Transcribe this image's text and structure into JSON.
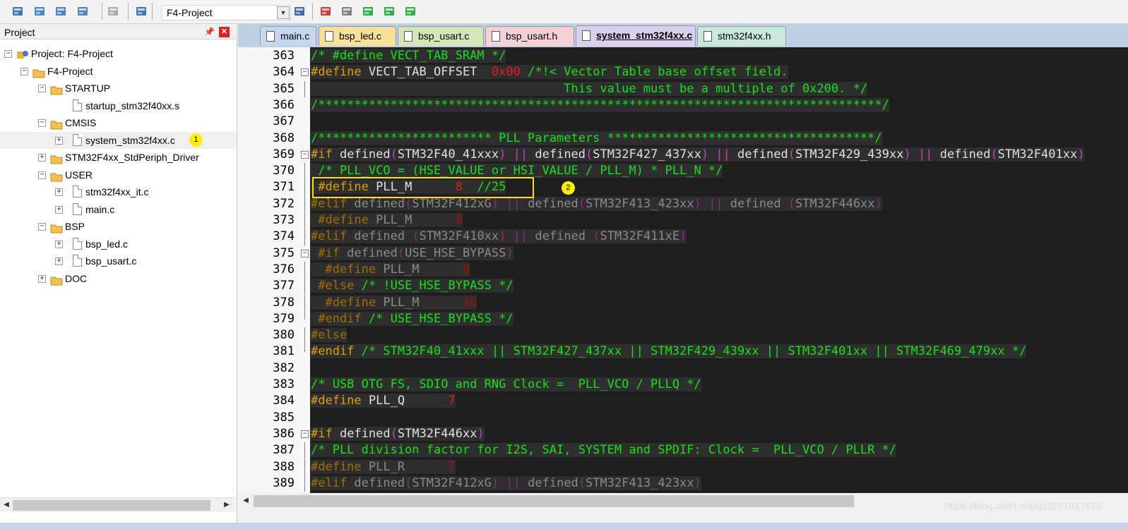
{
  "toolbar": {
    "target_name": "F4-Project",
    "buttons": [
      {
        "name": "translate-icon",
        "color": "#2060b0"
      },
      {
        "name": "build-icon",
        "color": "#3070c0"
      },
      {
        "name": "rebuild-icon",
        "color": "#3070c0"
      },
      {
        "name": "batch-build-icon",
        "color": "#3070c0"
      },
      {
        "name": "stop-build-icon",
        "color": "#9aa0a8"
      },
      {
        "name": "download-icon",
        "color": "#2060b0"
      },
      {
        "name": "options-for-target-icon",
        "color": "#2050a0"
      },
      {
        "name": "manage-project-items-icon",
        "color": "#c02020"
      },
      {
        "name": "select-packs-icon",
        "color": "#707070"
      },
      {
        "name": "manage-rte-icon",
        "color": "#10a030"
      },
      {
        "name": "pack-installer-icon",
        "color": "#10a030"
      },
      {
        "name": "pack-installer2-icon",
        "color": "#10a030"
      }
    ]
  },
  "project_panel": {
    "title": "Project",
    "tree": [
      {
        "label": "Project: F4-Project",
        "level": 0,
        "type": "project",
        "toggle": "-"
      },
      {
        "label": "F4-Project",
        "level": 1,
        "type": "target",
        "toggle": "-"
      },
      {
        "label": "STARTUP",
        "level": 2,
        "type": "folder",
        "toggle": "-"
      },
      {
        "label": "startup_stm32f40xx.s",
        "level": 3,
        "type": "file",
        "toggle": ""
      },
      {
        "label": "CMSIS",
        "level": 2,
        "type": "folder",
        "toggle": "-"
      },
      {
        "label": "system_stm32f4xx.c",
        "level": 3,
        "type": "file",
        "toggle": "+",
        "selected": true,
        "badge": "1"
      },
      {
        "label": "STM32F4xx_StdPeriph_Driver",
        "level": 2,
        "type": "folder",
        "toggle": "+"
      },
      {
        "label": "USER",
        "level": 2,
        "type": "folder",
        "toggle": "-"
      },
      {
        "label": "stm32f4xx_it.c",
        "level": 3,
        "type": "file",
        "toggle": "+"
      },
      {
        "label": "main.c",
        "level": 3,
        "type": "file",
        "toggle": "+"
      },
      {
        "label": "BSP",
        "level": 2,
        "type": "folder",
        "toggle": "-"
      },
      {
        "label": "bsp_led.c",
        "level": 3,
        "type": "file",
        "toggle": "+"
      },
      {
        "label": "bsp_usart.c",
        "level": 3,
        "type": "file",
        "toggle": "+"
      },
      {
        "label": "DOC",
        "level": 2,
        "type": "folder",
        "toggle": "+"
      }
    ]
  },
  "tabs": [
    {
      "label": "main.c",
      "color": "#c4d7ee",
      "active": false
    },
    {
      "label": "bsp_led.c",
      "color": "#f6e09a",
      "active": false
    },
    {
      "label": "bsp_usart.c",
      "color": "#d4e6b8",
      "active": false
    },
    {
      "label": "bsp_usart.h",
      "color": "#f4d0d4",
      "active": false
    },
    {
      "label": "system_stm32f4xx.c",
      "color": "#d8d0ec",
      "active": true
    },
    {
      "label": "stm32f4xx.h",
      "color": "#c8e8dc",
      "active": false
    }
  ],
  "editor": {
    "highlight_badge": "2",
    "lines": [
      {
        "num": "363",
        "fold": "",
        "segs": [
          [
            "c",
            "/* #define VECT_TAB_SRAM */"
          ]
        ]
      },
      {
        "num": "364",
        "fold": "-",
        "segs": [
          [
            "p",
            "#define"
          ],
          [
            "d",
            " VECT_TAB_OFFSET  "
          ],
          [
            "n",
            "0x00"
          ],
          [
            "c",
            " /*!< Vector Table base offset field."
          ]
        ]
      },
      {
        "num": "365",
        "fold": "|",
        "segs": [
          [
            "c",
            "                                   This value must be a multiple of 0x200. */"
          ]
        ]
      },
      {
        "num": "366",
        "fold": "",
        "segs": [
          [
            "c",
            "/******************************************************************************/"
          ]
        ]
      },
      {
        "num": "367",
        "fold": "",
        "segs": []
      },
      {
        "num": "368",
        "fold": "",
        "segs": [
          [
            "c",
            "/************************ PLL Parameters *************************************/"
          ]
        ]
      },
      {
        "num": "369",
        "fold": "-",
        "segs": [
          [
            "p",
            "#if"
          ],
          [
            "d",
            " defined"
          ],
          [
            "o",
            "("
          ],
          [
            "d",
            "STM32F40_41xxx"
          ],
          [
            "o",
            ")"
          ],
          [
            "d",
            " "
          ],
          [
            "o",
            "||"
          ],
          [
            "d",
            " defined"
          ],
          [
            "o",
            "("
          ],
          [
            "d",
            "STM32F427_437xx"
          ],
          [
            "o",
            ")"
          ],
          [
            "d",
            " "
          ],
          [
            "o",
            "||"
          ],
          [
            "d",
            " defined"
          ],
          [
            "o",
            "("
          ],
          [
            "d",
            "STM32F429_439xx"
          ],
          [
            "o",
            ")"
          ],
          [
            "d",
            " "
          ],
          [
            "o",
            "||"
          ],
          [
            "d",
            " defined"
          ],
          [
            "o",
            "("
          ],
          [
            "d",
            "STM32F401xx"
          ],
          [
            "o",
            ")"
          ]
        ]
      },
      {
        "num": "370",
        "fold": "|",
        "segs": [
          [
            "c",
            " /* PLL_VCO = (HSE_VALUE or HSI_VALUE / PLL_M) * PLL_N */"
          ]
        ]
      },
      {
        "num": "371",
        "fold": "|",
        "segs": [
          [
            "p",
            " #define"
          ],
          [
            "d",
            " PLL_M      "
          ],
          [
            "n",
            "8"
          ],
          [
            "c",
            "  //25"
          ]
        ]
      },
      {
        "num": "372",
        "fold": "|",
        "segs": [
          [
            "pd",
            "#elif"
          ],
          [
            "dd2",
            " defined"
          ],
          [
            "od",
            "("
          ],
          [
            "dd2",
            "STM32F412xG"
          ],
          [
            "od",
            ")"
          ],
          [
            "dd2",
            " "
          ],
          [
            "od",
            "||"
          ],
          [
            "dd2",
            " defined"
          ],
          [
            "od",
            "("
          ],
          [
            "dd2",
            "STM32F413_423xx"
          ],
          [
            "od",
            ")"
          ],
          [
            "dd2",
            " "
          ],
          [
            "od",
            "||"
          ],
          [
            "dd2",
            " defined "
          ],
          [
            "od",
            "("
          ],
          [
            "dd2",
            "STM32F446xx"
          ],
          [
            "od",
            ")"
          ]
        ]
      },
      {
        "num": "373",
        "fold": "|",
        "segs": [
          [
            "pd",
            " #define"
          ],
          [
            "dd2",
            " PLL_M      "
          ],
          [
            "nd",
            "8"
          ]
        ]
      },
      {
        "num": "374",
        "fold": "|",
        "segs": [
          [
            "pd",
            "#elif"
          ],
          [
            "dd2",
            " defined "
          ],
          [
            "od",
            "("
          ],
          [
            "dd2",
            "STM32F410xx"
          ],
          [
            "od",
            ")"
          ],
          [
            "dd2",
            " "
          ],
          [
            "od",
            "||"
          ],
          [
            "dd2",
            " defined "
          ],
          [
            "od",
            "("
          ],
          [
            "dd2",
            "STM32F411xE"
          ],
          [
            "od",
            ")"
          ]
        ]
      },
      {
        "num": "375",
        "fold": "-",
        "segs": [
          [
            "pd",
            " #if"
          ],
          [
            "dd2",
            " defined"
          ],
          [
            "od",
            "("
          ],
          [
            "dd2",
            "USE_HSE_BYPASS"
          ],
          [
            "od",
            ")"
          ]
        ]
      },
      {
        "num": "376",
        "fold": "|",
        "segs": [
          [
            "pd",
            "  #define"
          ],
          [
            "dd2",
            " PLL_M      "
          ],
          [
            "nd",
            "8"
          ]
        ]
      },
      {
        "num": "377",
        "fold": "|",
        "segs": [
          [
            "pd",
            " #else"
          ],
          [
            "c",
            " /* !USE_HSE_BYPASS */"
          ]
        ]
      },
      {
        "num": "378",
        "fold": "|",
        "segs": [
          [
            "pd",
            "  #define"
          ],
          [
            "dd2",
            " PLL_M      "
          ],
          [
            "nd",
            "16"
          ]
        ]
      },
      {
        "num": "379",
        "fold": "L",
        "segs": [
          [
            "pd",
            " #endif"
          ],
          [
            "c",
            " /* USE_HSE_BYPASS */"
          ]
        ]
      },
      {
        "num": "380",
        "fold": "|",
        "segs": [
          [
            "pd",
            "#else"
          ]
        ]
      },
      {
        "num": "381",
        "fold": "L",
        "segs": [
          [
            "p",
            "#endif"
          ],
          [
            "c",
            " /* STM32F40_41xxx || STM32F427_437xx || STM32F429_439xx || STM32F401xx || STM32F469_479xx */"
          ]
        ]
      },
      {
        "num": "382",
        "fold": "",
        "segs": []
      },
      {
        "num": "383",
        "fold": "",
        "segs": [
          [
            "c",
            "/* USB OTG FS, SDIO and RNG Clock =  PLL_VCO / PLLQ */"
          ]
        ]
      },
      {
        "num": "384",
        "fold": "",
        "segs": [
          [
            "p",
            "#define"
          ],
          [
            "d",
            " PLL_Q      "
          ],
          [
            "n",
            "7"
          ]
        ]
      },
      {
        "num": "385",
        "fold": "",
        "segs": []
      },
      {
        "num": "386",
        "fold": "-",
        "segs": [
          [
            "p",
            "#if"
          ],
          [
            "d",
            " defined"
          ],
          [
            "o",
            "("
          ],
          [
            "d",
            "STM32F446xx"
          ],
          [
            "o",
            ")"
          ]
        ]
      },
      {
        "num": "387",
        "fold": "|",
        "segs": [
          [
            "c",
            "/* PLL division factor for I2S, SAI, SYSTEM and SPDIF: Clock =  PLL_VCO / PLLR */"
          ]
        ]
      },
      {
        "num": "388",
        "fold": "|",
        "segs": [
          [
            "pd",
            "#define"
          ],
          [
            "dd2",
            " PLL_R      "
          ],
          [
            "nd",
            "7"
          ]
        ]
      },
      {
        "num": "389",
        "fold": "|",
        "segs": [
          [
            "pd",
            "#elif"
          ],
          [
            "dd2",
            " defined"
          ],
          [
            "od",
            "("
          ],
          [
            "dd2",
            "STM32F412xG"
          ],
          [
            "od",
            ")"
          ],
          [
            "dd2",
            " "
          ],
          [
            "od",
            "||"
          ],
          [
            "dd2",
            " defined"
          ],
          [
            "od",
            "("
          ],
          [
            "dd2",
            "STM32F413_423xx"
          ],
          [
            "od",
            ")"
          ]
        ]
      }
    ]
  },
  "watermark": "https://blog.csdn.net/qq1291917670"
}
